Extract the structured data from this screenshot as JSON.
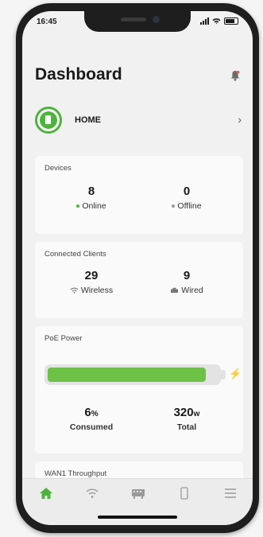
{
  "status": {
    "time": "16:45"
  },
  "header": {
    "title": "Dashboard"
  },
  "site": {
    "name": "HOME"
  },
  "devices": {
    "title": "Devices",
    "online": {
      "value": "8",
      "label": "Online"
    },
    "offline": {
      "value": "0",
      "label": "Offline"
    }
  },
  "clients": {
    "title": "Connected Clients",
    "wireless": {
      "value": "29",
      "label": "Wireless"
    },
    "wired": {
      "value": "9",
      "label": "Wired"
    }
  },
  "poe": {
    "title": "PoE Power",
    "consumed": {
      "value": "6",
      "unit": "%",
      "label": "Consumed"
    },
    "total": {
      "value": "320",
      "unit": "w",
      "label": "Total"
    },
    "bar_fill_fraction": 0.93
  },
  "wan": {
    "title": "WAN1 Throughput"
  },
  "tabs": [
    {
      "icon": "home-icon",
      "active": true
    },
    {
      "icon": "wifi-icon",
      "active": false
    },
    {
      "icon": "switch-icon",
      "active": false
    },
    {
      "icon": "phone-icon",
      "active": false
    },
    {
      "icon": "menu-icon",
      "active": false
    }
  ],
  "colors": {
    "accent": "#4db33d",
    "bar": "#6cc146"
  }
}
